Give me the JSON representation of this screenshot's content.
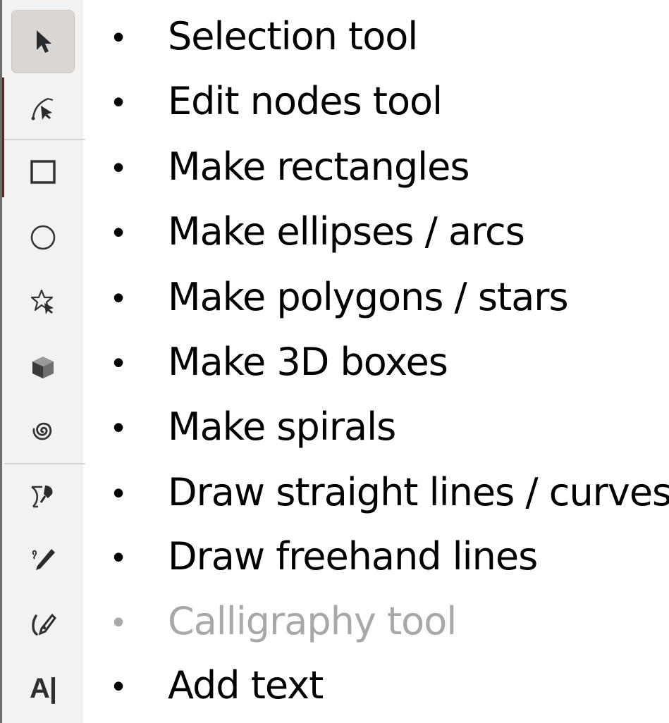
{
  "toolbar": {
    "tools": [
      {
        "icon": "selection-arrow-icon",
        "active": true
      },
      {
        "icon": "edit-nodes-icon",
        "active": false
      },
      {
        "icon": "rectangle-icon",
        "active": false
      },
      {
        "icon": "ellipse-icon",
        "active": false
      },
      {
        "icon": "star-polygon-icon",
        "active": false
      },
      {
        "icon": "3d-box-icon",
        "active": false
      },
      {
        "icon": "spiral-icon",
        "active": false
      },
      {
        "icon": "bezier-pen-icon",
        "active": false
      },
      {
        "icon": "pencil-icon",
        "active": false
      },
      {
        "icon": "calligraphy-pen-icon",
        "active": false
      },
      {
        "icon": "text-icon",
        "label": "A|",
        "active": false
      }
    ]
  },
  "items": [
    {
      "label": "Selection tool"
    },
    {
      "label": "Edit nodes tool"
    },
    {
      "label": "Make rectangles"
    },
    {
      "label": "Make ellipses / arcs"
    },
    {
      "label": "Make polygons / stars"
    },
    {
      "label": "Make 3D boxes"
    },
    {
      "label": "Make spirals"
    },
    {
      "label": "Draw straight lines / curves"
    },
    {
      "label": "Draw freehand lines"
    },
    {
      "label": "Calligraphy tool",
      "dimmed": true
    },
    {
      "label": "Add text"
    }
  ],
  "bullet": "•",
  "colors": {
    "text": "#000000",
    "dimmed_text": "#a8a8a8",
    "toolbar_bg": "#f2f2f2",
    "active_tool_bg": "#d9d6d4"
  }
}
